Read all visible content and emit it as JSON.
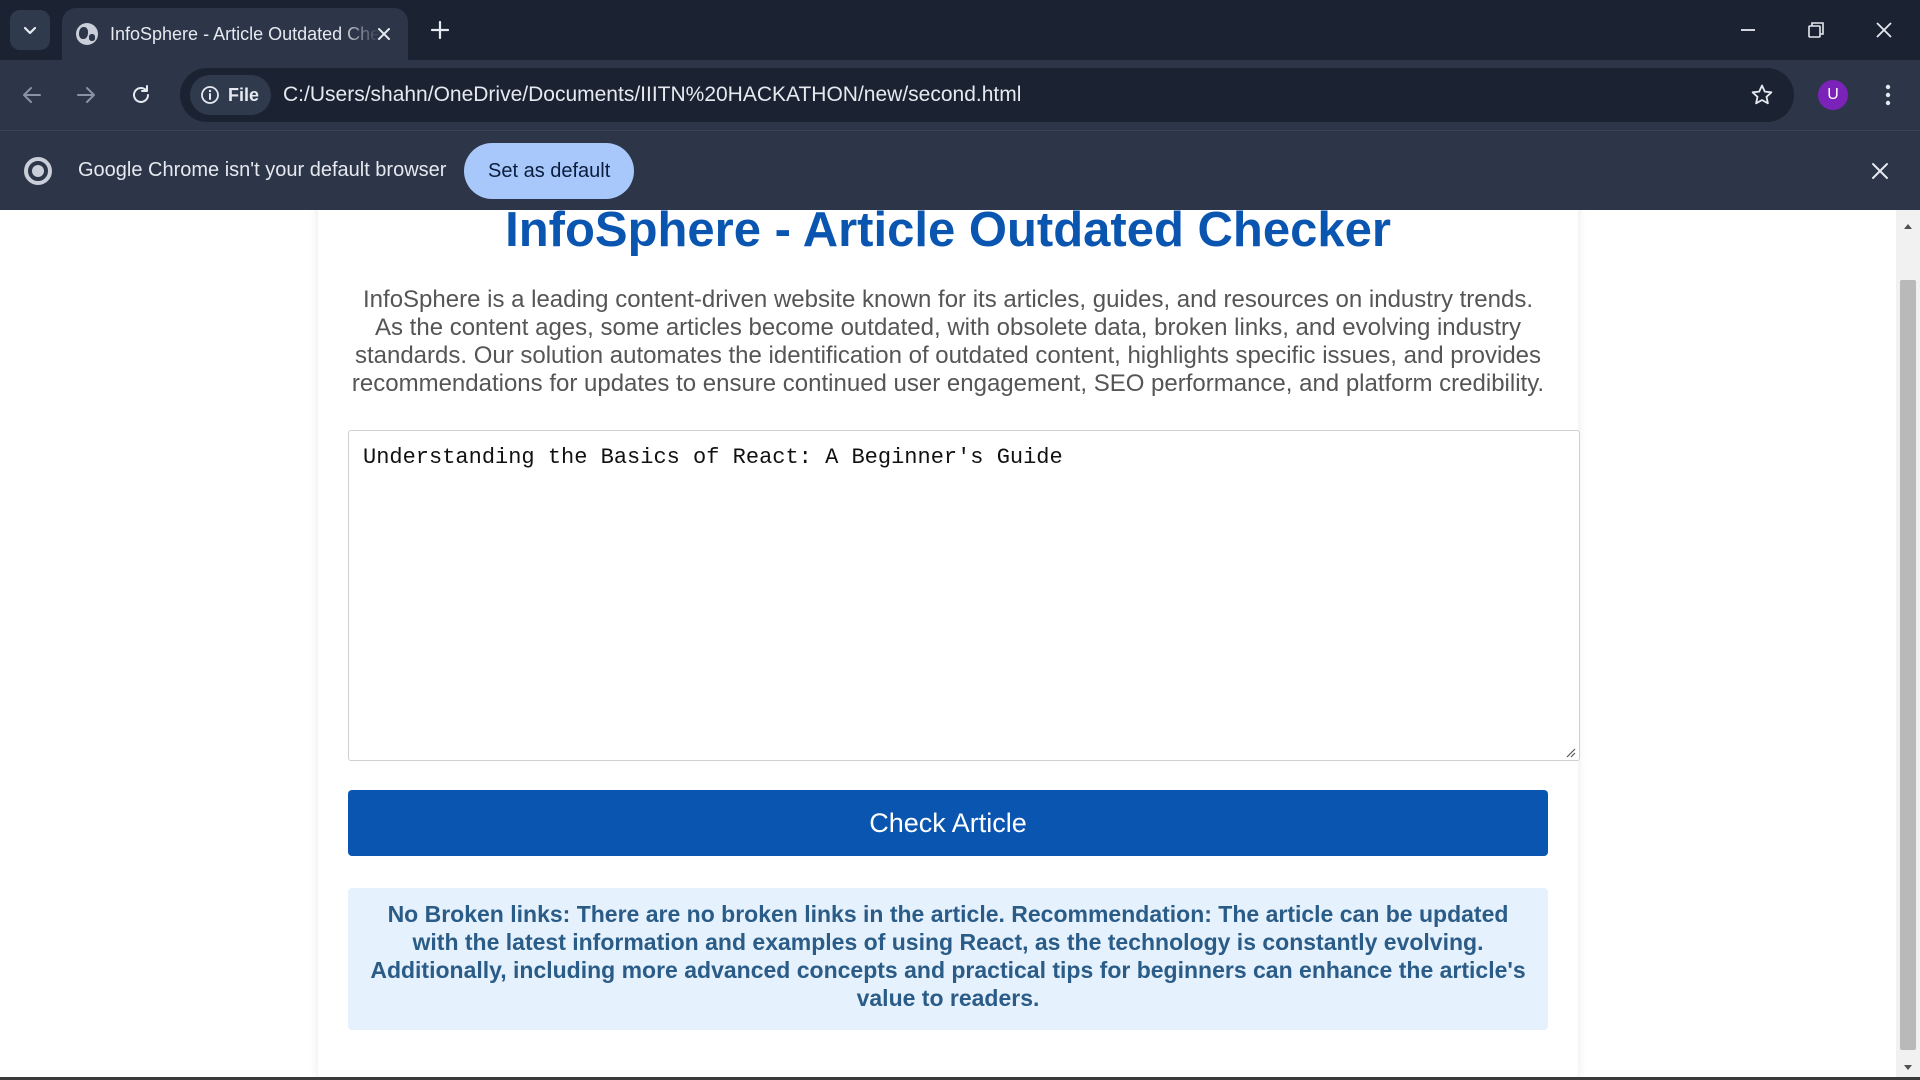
{
  "browser": {
    "tab_title": "InfoSphere - Article Outdated Checker",
    "address_chip": "File",
    "url": "C:/Users/shahn/OneDrive/Documents/IIITN%20HACKATHON/new/second.html",
    "profile_initial": "U",
    "infobar_text": "Google Chrome isn't your default browser",
    "infobar_button": "Set as default"
  },
  "page": {
    "title": "InfoSphere - Article Outdated Checker",
    "description": "InfoSphere is a leading content-driven website known for its articles, guides, and resources on industry trends. As the content ages, some articles become outdated, with obsolete data, broken links, and evolving industry standards. Our solution automates the identification of outdated content, highlights specific issues, and provides recommendations for updates to ensure continued user engagement, SEO performance, and platform credibility.",
    "article_input_value": "Understanding the Basics of React: A Beginner's Guide",
    "check_button": "Check Article",
    "result_text": "No Broken links: There are no broken links in the article. Recommendation: The article can be updated with the latest information and examples of using React, as the technology is constantly evolving. Additionally, including more advanced concepts and practical tips for beginners can enhance the article's value to readers."
  },
  "colors": {
    "chrome_dark": "#1b2332",
    "chrome_toolbar": "#2c3648",
    "accent_blue": "#0a55b0",
    "result_bg": "#e5f1fc",
    "result_text": "#2a5c87",
    "set_default_bg": "#a8c7fa",
    "avatar_bg": "#7b22b8"
  },
  "icons": [
    "tab-search-icon",
    "globe-icon",
    "close-icon",
    "plus-icon",
    "minimize-icon",
    "restore-icon",
    "back-arrow-icon",
    "forward-arrow-icon",
    "reload-icon",
    "info-icon",
    "star-icon",
    "more-vert-icon",
    "chrome-logo-icon",
    "resize-grip-icon",
    "scroll-up-icon",
    "scroll-down-icon"
  ]
}
